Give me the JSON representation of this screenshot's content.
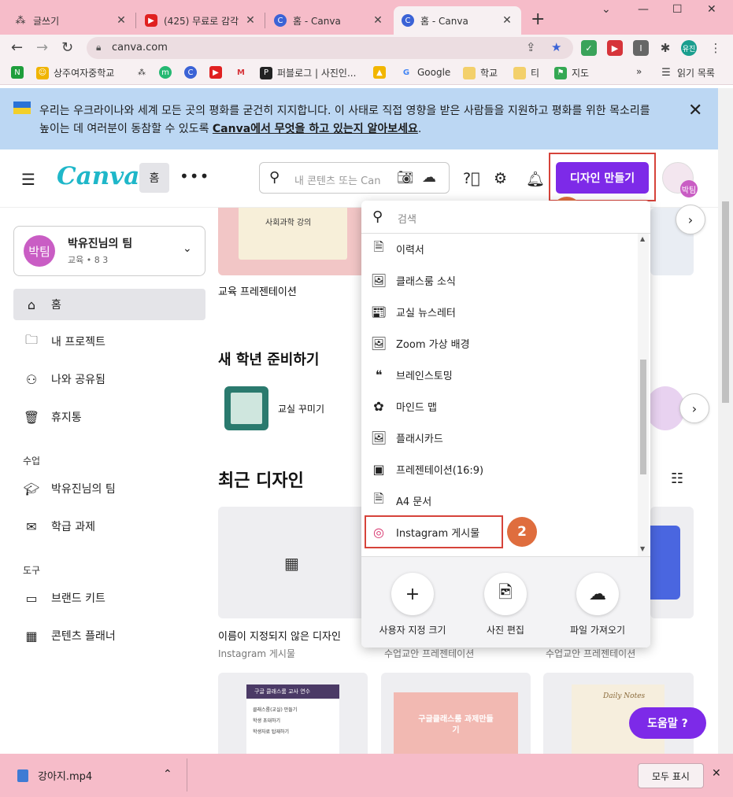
{
  "browser": {
    "tabs": [
      {
        "title": "글쓰기",
        "fav_color": "#3a3a3a"
      },
      {
        "title": "(425) 무료로 감각",
        "fav_color": "#e02020"
      },
      {
        "title": "홈 - Canva",
        "fav_color": "#3b63d6"
      },
      {
        "title": "홈 - Canva",
        "fav_color": "#3b63d6"
      }
    ],
    "url": "canva.com",
    "profile": "유진",
    "bookmarks": [
      "상주여자중학교",
      "퍼블로그 | 사진인...",
      "Google",
      "학교",
      "티",
      "지도"
    ],
    "reading_list": "읽기 목록"
  },
  "banner": {
    "message": "우리는 우크라이나와 세계 모든 곳의 평화를 굳건히 지지합니다. 이 사태로 직접 영향을 받은 사람들을 지원하고 평화를 위한 목소리를 높이는 데 여러분이 동참할 수 있도록 ",
    "link": "Canva에서 무엇을 하고 있는지 알아보세요",
    "suffix": "."
  },
  "header": {
    "logo": "Canva",
    "home": "홈",
    "search_placeholder": "내 콘텐츠 또는 Canva",
    "create_button": "디자인 만들기",
    "avatar": "박팀"
  },
  "sidebar": {
    "team": {
      "avatar": "박팀",
      "name": "박유진님의 팀",
      "meta": "교육 • 8 3"
    },
    "items": [
      {
        "label": "홈",
        "icon": "home-icon"
      },
      {
        "label": "내 프로젝트",
        "icon": "folder-icon"
      },
      {
        "label": "나와 공유됨",
        "icon": "shared-icon"
      },
      {
        "label": "휴지통",
        "icon": "trash-icon"
      }
    ],
    "section_class": "수업",
    "class_items": [
      {
        "label": "박유진님의 팀",
        "icon": "graduation-icon"
      },
      {
        "label": "학급 과제",
        "icon": "inbox-icon"
      }
    ],
    "section_tools": "도구",
    "tool_items": [
      {
        "label": "브랜드 키트",
        "icon": "brand-kit-icon"
      },
      {
        "label": "콘텐츠 플래너",
        "icon": "calendar-icon"
      }
    ]
  },
  "main": {
    "top_card_label": "교육 프레젠테이션",
    "top_card_thumb_title": "사회과학 강의",
    "section_new_year": "새 학년 준비하기",
    "classroom_label": "교실 꾸미기",
    "section_recent": "최근 디자인",
    "recent": [
      {
        "title": "이름이 지정되지 않은 디자인",
        "type": "Instagram 게시물"
      },
      {
        "tag": "수업교안",
        "type": "프레젠테이션"
      },
      {
        "tag": "수업교안",
        "type": "프레젠테이션"
      }
    ],
    "thumb_1_title": "구글 클래스룸 교사 연수",
    "thumb_1_items": [
      "클래스룸(교실) 만들기",
      "학생 초대하기",
      "학생자료 탑재하기"
    ],
    "thumb_2_title": "구글클래스룸 과제만들기",
    "thumb_3_title": "Daily Notes"
  },
  "dropdown": {
    "search_placeholder": "검색",
    "items": [
      {
        "label": "이력서",
        "icon": "document-icon"
      },
      {
        "label": "클래스룸 소식",
        "icon": "image-icon"
      },
      {
        "label": "교실 뉴스레터",
        "icon": "newsletter-icon"
      },
      {
        "label": "Zoom 가상 배경",
        "icon": "image-icon"
      },
      {
        "label": "브레인스토밍",
        "icon": "brainstorm-icon"
      },
      {
        "label": "마인드 맵",
        "icon": "mindmap-icon"
      },
      {
        "label": "플래시카드",
        "icon": "image-icon"
      },
      {
        "label": "프레젠테이션(16:9)",
        "icon": "presentation-icon"
      },
      {
        "label": "A4 문서",
        "icon": "document-icon"
      },
      {
        "label": "Instagram 게시물",
        "icon": "instagram-icon"
      }
    ],
    "actions": [
      {
        "label": "사용자 지정 크기",
        "icon": "plus-icon"
      },
      {
        "label": "사진 편집",
        "icon": "photo-edit-icon"
      },
      {
        "label": "파일 가져오기",
        "icon": "upload-icon"
      }
    ]
  },
  "annotations": {
    "step1": "1",
    "step2": "2"
  },
  "help_button": "도움말 ?",
  "downloads": {
    "file": "강아지.mp4",
    "show_all": "모두 표시"
  },
  "colors": {
    "accent": "#7d2ae8",
    "canva": "#1fb7c9",
    "chrome": "#f6bcc9",
    "annotation": "#df6d3e"
  }
}
